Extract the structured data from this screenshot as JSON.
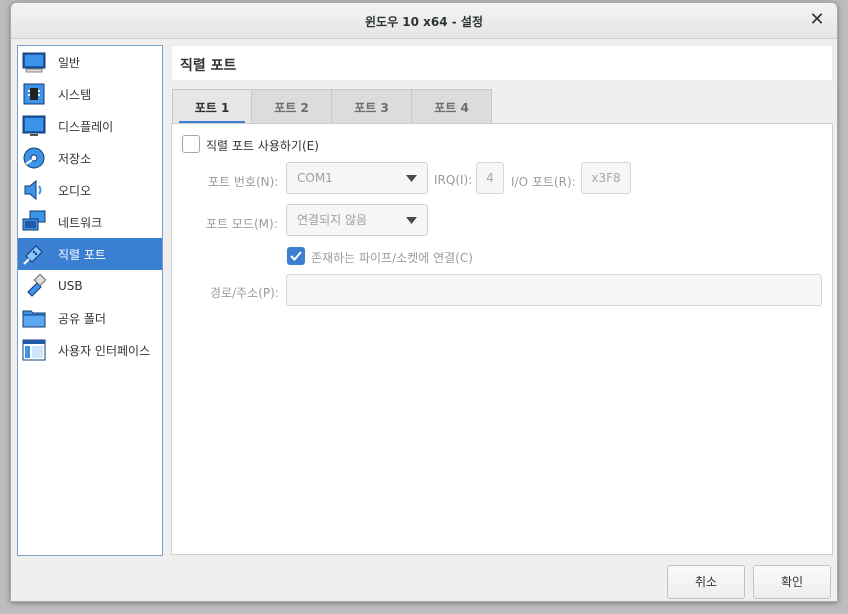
{
  "window": {
    "title": "윈도우 10 x64 - 설정"
  },
  "sidebar": {
    "items": [
      {
        "label": "일반",
        "icon": "general-icon"
      },
      {
        "label": "시스템",
        "icon": "system-icon"
      },
      {
        "label": "디스플레이",
        "icon": "display-icon"
      },
      {
        "label": "저장소",
        "icon": "storage-icon"
      },
      {
        "label": "오디오",
        "icon": "audio-icon"
      },
      {
        "label": "네트워크",
        "icon": "network-icon"
      },
      {
        "label": "직렬 포트",
        "icon": "serial-port-icon",
        "selected": true
      },
      {
        "label": "USB",
        "icon": "usb-icon"
      },
      {
        "label": "공유 폴더",
        "icon": "shared-folder-icon"
      },
      {
        "label": "사용자 인터페이스",
        "icon": "user-interface-icon"
      }
    ]
  },
  "page": {
    "title": "직렬 포트"
  },
  "tabs": [
    {
      "label": "포트 1",
      "active": true
    },
    {
      "label": "포트 2"
    },
    {
      "label": "포트 3"
    },
    {
      "label": "포트 4"
    }
  ],
  "port": {
    "enable_label": "직렬 포트 사용하기(E)",
    "enable_checked": false,
    "port_number_label": "포트 번호(N):",
    "port_number_value": "COM1",
    "irq_label": "IRQ(I):",
    "irq_value": "4",
    "io_port_label": "I/O 포트(R):",
    "io_port_value": "x3F8",
    "port_mode_label": "포트 모드(M):",
    "port_mode_value": "연결되지 않음",
    "connect_existing_label": "존재하는 파이프/소켓에 연결(C)",
    "connect_existing_checked": true,
    "path_label": "경로/주소(P):",
    "path_value": ""
  },
  "buttons": {
    "cancel": "취소",
    "ok": "확인"
  },
  "colors": {
    "accent": "#3b7fd3"
  }
}
